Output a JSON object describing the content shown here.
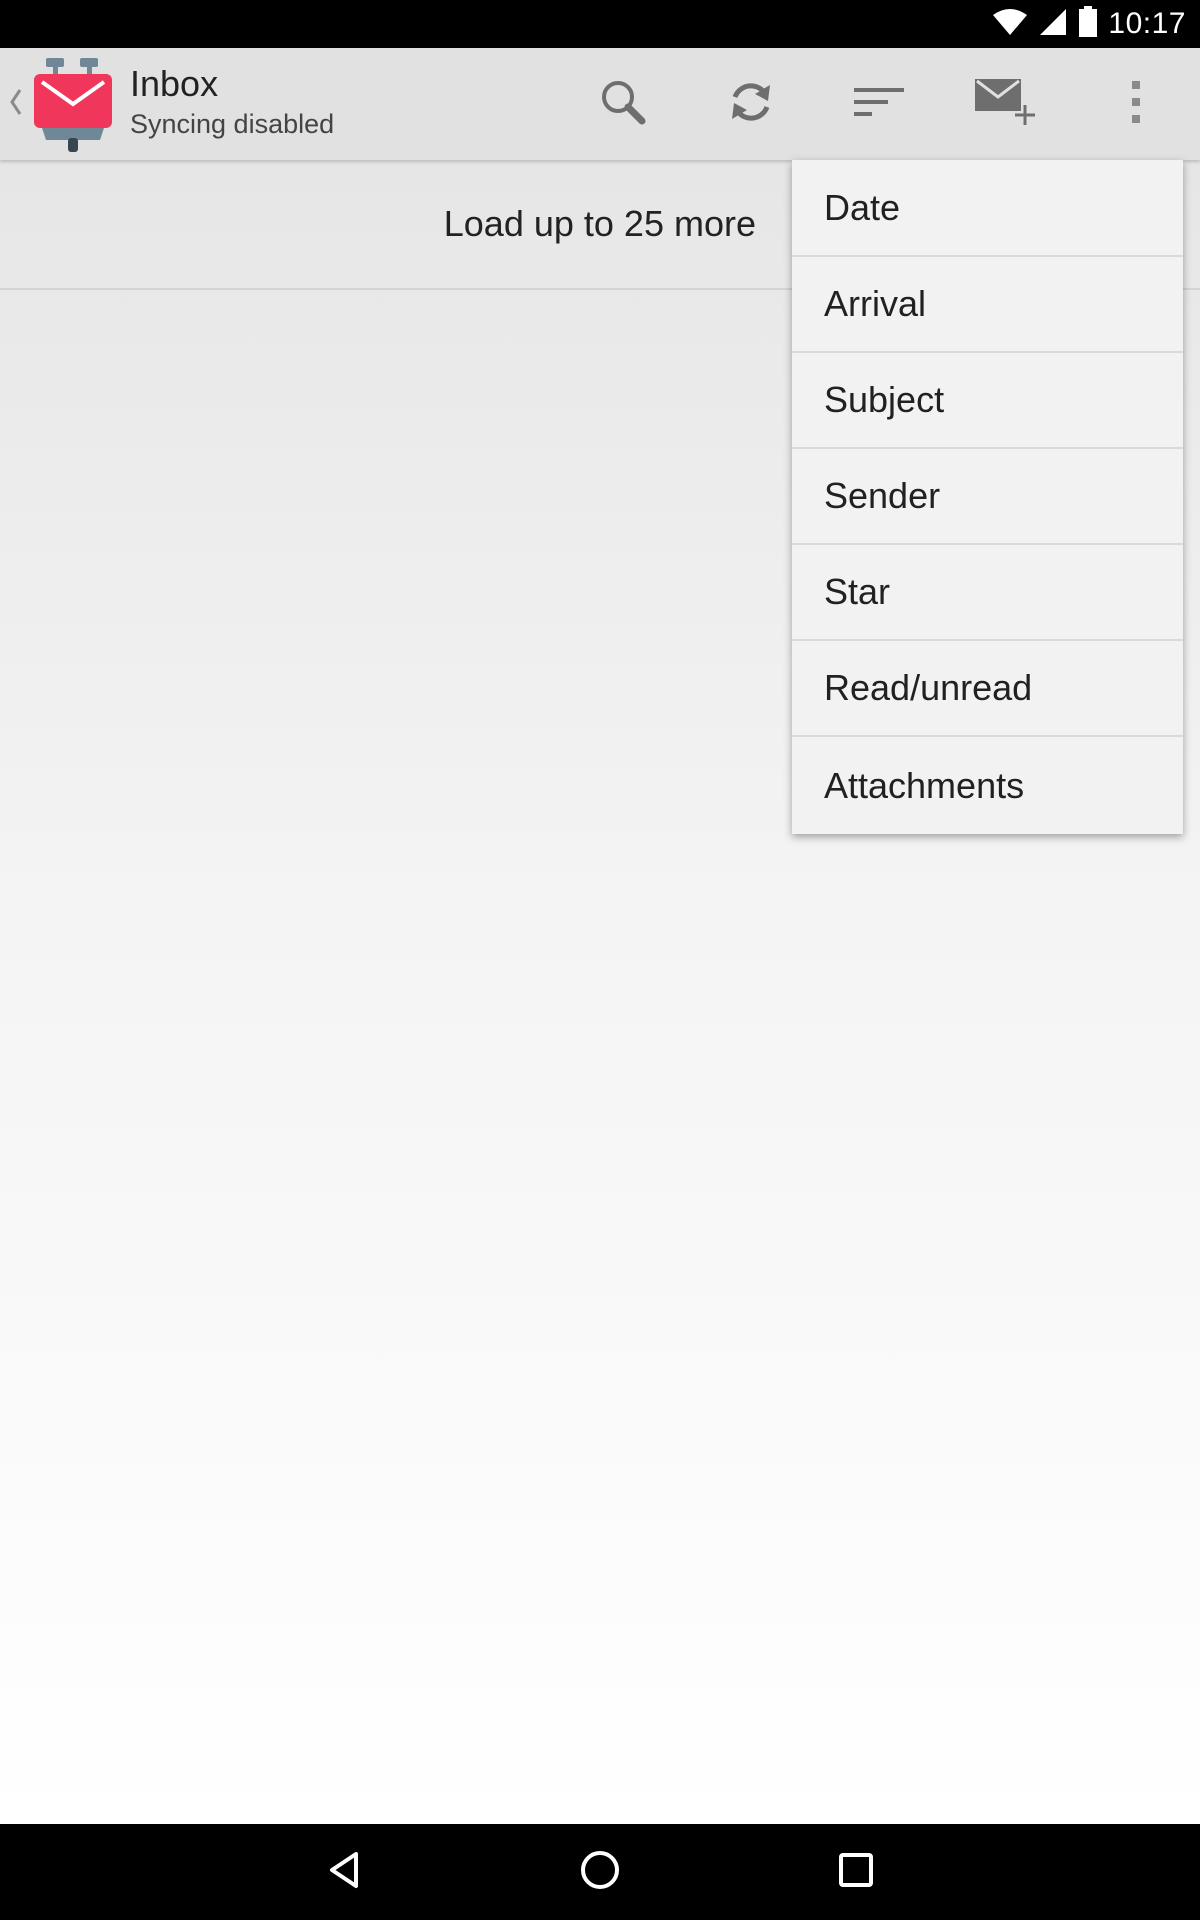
{
  "status_bar": {
    "time": "10:17",
    "icons": [
      "wifi-icon",
      "cell-signal-icon",
      "battery-icon"
    ]
  },
  "action_bar": {
    "title": "Inbox",
    "subtitle": "Syncing disabled",
    "actions": [
      "search-icon",
      "refresh-icon",
      "sort-icon",
      "compose-icon",
      "overflow-menu-icon"
    ]
  },
  "message_list": {
    "load_more_label": "Load up to 25 more"
  },
  "sort_menu": {
    "items": [
      "Date",
      "Arrival",
      "Subject",
      "Sender",
      "Star",
      "Read/unread",
      "Attachments"
    ]
  },
  "nav_bar": {
    "buttons": [
      "back-icon",
      "home-icon",
      "recents-icon"
    ]
  },
  "colors": {
    "app_icon_red": "#f0365a",
    "action_bar_bg": "#e1e1e1",
    "icon_gray": "#6e6e6e"
  }
}
